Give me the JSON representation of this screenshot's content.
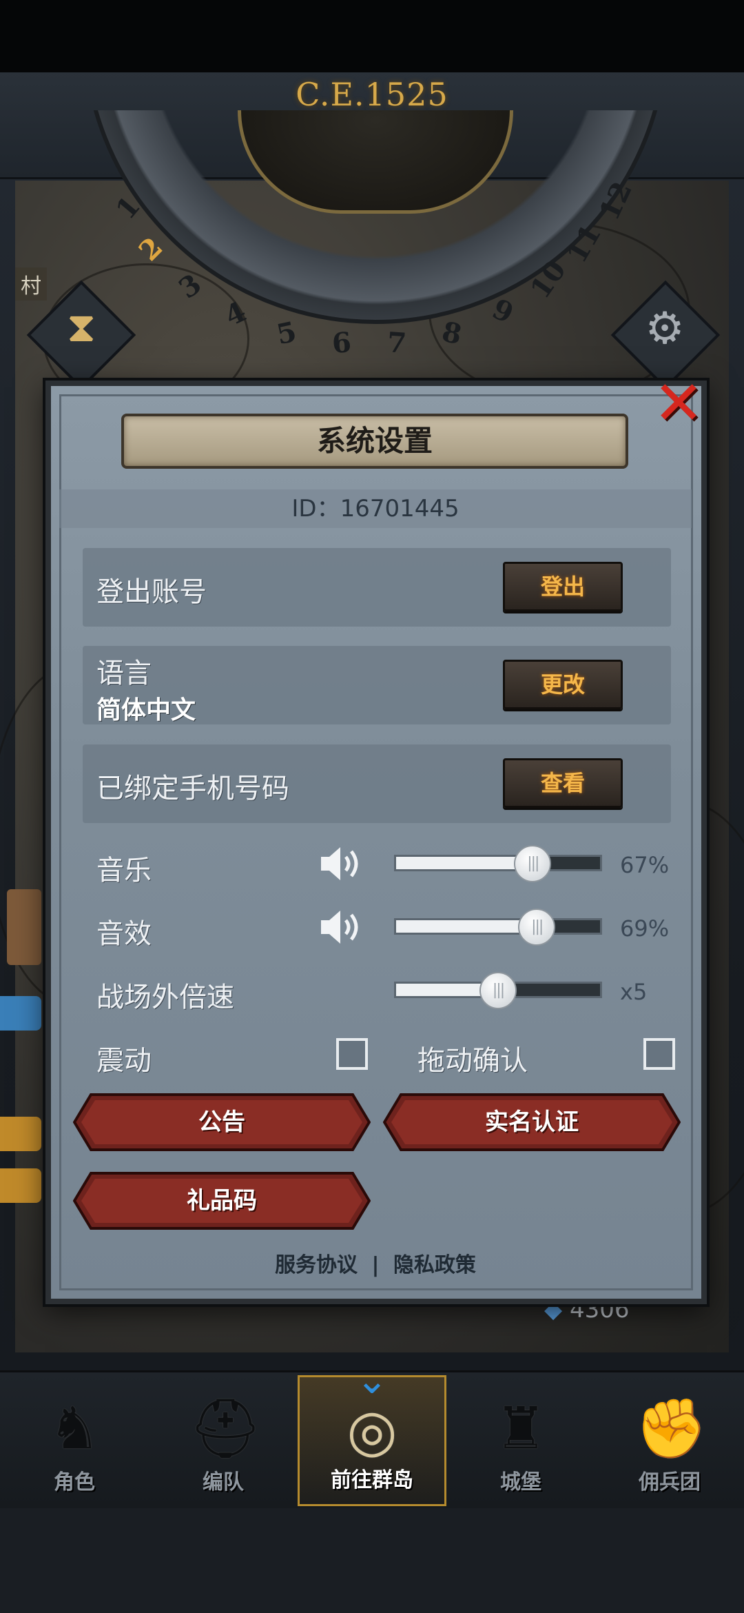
{
  "header": {
    "era": "C.E.1525",
    "wheel_numbers": [
      "1",
      "2",
      "3",
      "4",
      "5",
      "6",
      "7",
      "8",
      "9",
      "10",
      "11",
      "12"
    ],
    "map_label": "村"
  },
  "dialog": {
    "title": "系统设置",
    "id_text": "ID：16701445",
    "logout": {
      "label": "登出账号",
      "button": "登出"
    },
    "language": {
      "label": "语言",
      "value": "简体中文",
      "button": "更改"
    },
    "phone": {
      "label": "已绑定手机号码",
      "button": "查看"
    },
    "music": {
      "label": "音乐",
      "value": 67,
      "value_text": "67%"
    },
    "sfx": {
      "label": "音效",
      "value": 69,
      "value_text": "69%"
    },
    "speed": {
      "label": "战场外倍速",
      "value_text": "x5",
      "level": 0.5
    },
    "vibration": {
      "label": "震动",
      "checked": false
    },
    "drag_confirm": {
      "label": "拖动确认",
      "checked": false
    },
    "buttons": {
      "notice": "公告",
      "realname": "实名认证",
      "gift": "礼品码"
    },
    "footer": {
      "terms": "服务协议",
      "separator": "|",
      "privacy": "隐私政策"
    }
  },
  "resources": {
    "gems": "4306"
  },
  "nav": [
    {
      "label": "角色",
      "icon": "knight-icon"
    },
    {
      "label": "编队",
      "icon": "helmet-icon"
    },
    {
      "label": "前往群岛",
      "icon": "globe-icon",
      "active": true
    },
    {
      "label": "城堡",
      "icon": "castle-icon"
    },
    {
      "label": "佣兵团",
      "icon": "fist-icon"
    }
  ],
  "colors": {
    "accent_gold": "#f5b74a",
    "banner_red": "#7a2520",
    "close_red": "#d6271e",
    "nav_active": "#b58b2e"
  }
}
